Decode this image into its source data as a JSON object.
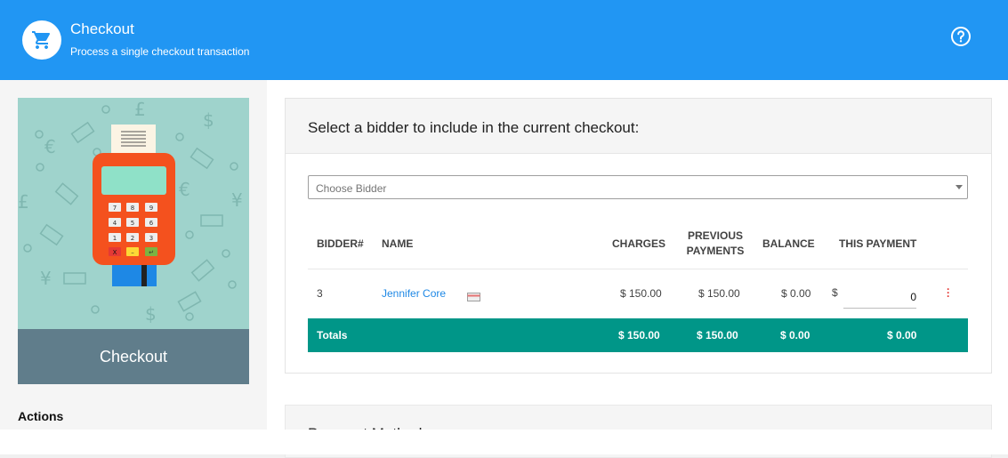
{
  "header": {
    "title": "Checkout",
    "subtitle": "Process a single checkout transaction",
    "logo_icon": "cart-icon",
    "help_icon": "help-circle-icon",
    "bg_color": "#2196f3"
  },
  "sidebar": {
    "illustration_caption": "Checkout",
    "actions_title": "Actions"
  },
  "main": {
    "card_title": "Select a bidder to include in the current checkout:",
    "bidder_select": {
      "placeholder": "Choose Bidder"
    },
    "table": {
      "headers": {
        "bidder": "BIDDER#",
        "name": "NAME",
        "charges": "CHARGES",
        "previous_payments_line1": "PREVIOUS",
        "previous_payments_line2": "PAYMENTS",
        "balance": "BALANCE",
        "this_payment": "THIS PAYMENT"
      },
      "rows": [
        {
          "bidder": "3",
          "name": "Jennifer Core",
          "card_icon": "credit-card-icon",
          "charges": "$ 150.00",
          "previous_payments": "$ 150.00",
          "balance": "$ 0.00",
          "currency": "$",
          "this_payment": "0",
          "menu_icon": "kebab-menu-icon"
        }
      ],
      "totals": {
        "label": "Totals",
        "charges": "$ 150.00",
        "previous_payments": "$ 150.00",
        "balance": "$ 0.00",
        "this_payment": "$ 0.00"
      }
    },
    "second_card_title": "Payment Method"
  }
}
